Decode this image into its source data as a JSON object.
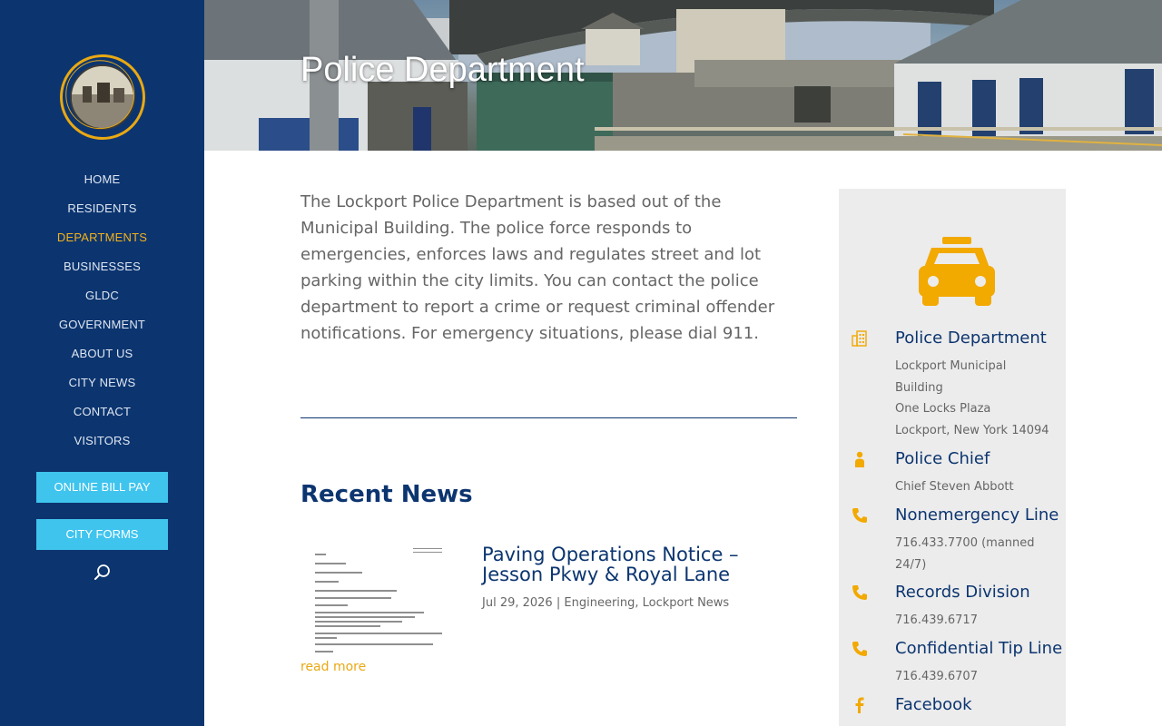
{
  "sidebar": {
    "logo_alt": "City of Lockport N.Y. seal",
    "nav": [
      {
        "label": "HOME",
        "active": false
      },
      {
        "label": "RESIDENTS",
        "active": false
      },
      {
        "label": "DEPARTMENTS",
        "active": true
      },
      {
        "label": "BUSINESSES",
        "active": false
      },
      {
        "label": "GLDC",
        "active": false
      },
      {
        "label": "GOVERNMENT",
        "active": false
      },
      {
        "label": "ABOUT US",
        "active": false
      },
      {
        "label": "CITY NEWS",
        "active": false
      },
      {
        "label": "CONTACT",
        "active": false
      },
      {
        "label": "VISITORS",
        "active": false
      }
    ],
    "bill_pay_label": "ONLINE BILL PAY",
    "forms_label": "CITY FORMS",
    "search_icon": "search-icon"
  },
  "hero": {
    "title": "Police Department"
  },
  "main": {
    "intro": "The Lockport Police Department is based out of the Municipal Building. The police force responds to emergencies, enforces laws and regulates street and lot parking within the city limits. You can contact the police department to report a crime or request criminal offender notifications. For emergency situations, please dial 911.",
    "recent_news_title": "Recent News",
    "post": {
      "title": "Paving Operations Notice – Jesson Pkwy & Royal Lane",
      "date": "Jul 29, 2026",
      "separator": "|",
      "categories": "Engineering, Lockport News",
      "read_more": "read more"
    }
  },
  "card": {
    "colors": {
      "accent": "#f2a900",
      "title": "#0c3570"
    },
    "items": [
      {
        "icon": "building-icon",
        "title": "Police Department",
        "lines": [
          "Lockport Municipal",
          "Building",
          "One Locks Plaza",
          "Lockport, New York 14094"
        ]
      },
      {
        "icon": "person-icon",
        "title": "Police Chief",
        "lines": [
          "Chief Steven Abbott"
        ]
      },
      {
        "icon": "phone-icon",
        "title": "Nonemergency Line",
        "lines": [
          "716.433.7700 (manned",
          "24/7)"
        ]
      },
      {
        "icon": "phone-icon",
        "title": "Records Division",
        "lines": [
          "716.439.6717"
        ]
      },
      {
        "icon": "phone-icon",
        "title": "Confidential Tip Line",
        "lines": [
          "716.439.6707"
        ]
      },
      {
        "icon": "facebook-icon",
        "title": "Facebook",
        "lines": []
      }
    ]
  }
}
